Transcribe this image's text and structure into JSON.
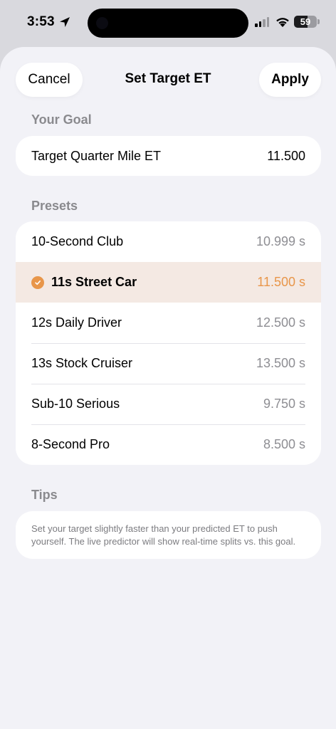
{
  "status_bar": {
    "time": "3:53",
    "location_icon": "location-arrow-icon",
    "signal_bars": 4,
    "signal_active_bars": 2,
    "battery_percent": "59",
    "battery_level": 0.59
  },
  "header": {
    "cancel_label": "Cancel",
    "title": "Set Target ET",
    "apply_label": "Apply"
  },
  "goal": {
    "section_label": "Your Goal",
    "label": "Target Quarter Mile ET",
    "value": "11.500"
  },
  "presets": {
    "section_label": "Presets",
    "items": [
      {
        "name": "10-Second Club",
        "value": "10.999 s",
        "selected": false
      },
      {
        "name": "11s Street Car",
        "value": "11.500 s",
        "selected": true
      },
      {
        "name": "12s Daily Driver",
        "value": "12.500 s",
        "selected": false
      },
      {
        "name": "13s Stock Cruiser",
        "value": "13.500 s",
        "selected": false
      },
      {
        "name": "Sub-10 Serious",
        "value": "9.750 s",
        "selected": false
      },
      {
        "name": "8-Second Pro",
        "value": "8.500 s",
        "selected": false
      }
    ]
  },
  "tips": {
    "section_label": "Tips",
    "text": "Set your target slightly faster than your predicted ET to push yourself. The live predictor will show real-time splits vs. this goal."
  },
  "colors": {
    "accent": "#e8964a",
    "selected_row_bg": "#f4e9e3",
    "sheet_bg": "#f2f2f7"
  }
}
